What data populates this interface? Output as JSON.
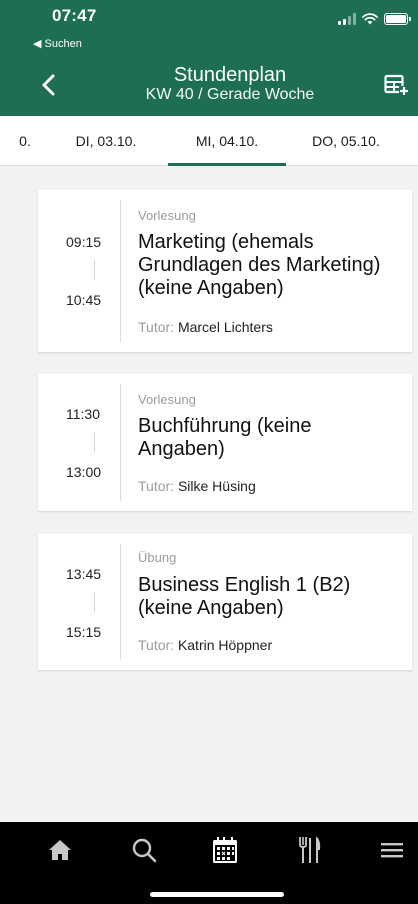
{
  "status_bar": {
    "time": "07:47",
    "back_label": "◀ Suchen"
  },
  "header": {
    "title": "Stundenplan",
    "subtitle": "KW 40 / Gerade Woche",
    "back_icon": "chevron-left-icon",
    "action_icon": "calendar-grid-add-icon"
  },
  "tabs": [
    {
      "label": "0."
    },
    {
      "label": "DI, 03.10."
    },
    {
      "label": "MI, 04.10.",
      "selected": true
    },
    {
      "label": "DO, 05.10."
    }
  ],
  "events": [
    {
      "start": "09:15",
      "end": "10:45",
      "type": "Vorlesung",
      "title": "Marketing (ehemals Grundlagen des Marketing) (keine Angaben)",
      "tutor_label": "Tutor:",
      "tutor": "Marcel Lichters"
    },
    {
      "start": "11:30",
      "end": "13:00",
      "type": "Vorlesung",
      "title": "Buchführung (keine Angaben)",
      "tutor_label": "Tutor:",
      "tutor": "Silke Hüsing"
    },
    {
      "start": "13:45",
      "end": "15:15",
      "type": "Übung",
      "title": "Business English 1 (B2) (keine Angaben)",
      "tutor_label": "Tutor:",
      "tutor": "Katrin Höppner"
    }
  ],
  "bottom_nav": [
    {
      "icon": "home-icon"
    },
    {
      "icon": "search-icon"
    },
    {
      "icon": "calendar-icon",
      "active": true
    },
    {
      "icon": "fork-knife-icon"
    },
    {
      "icon": "menu-icon"
    }
  ],
  "colors": {
    "brand": "#1d6e52",
    "background": "#f2f2f2",
    "muted_text": "#9b9b9b"
  }
}
